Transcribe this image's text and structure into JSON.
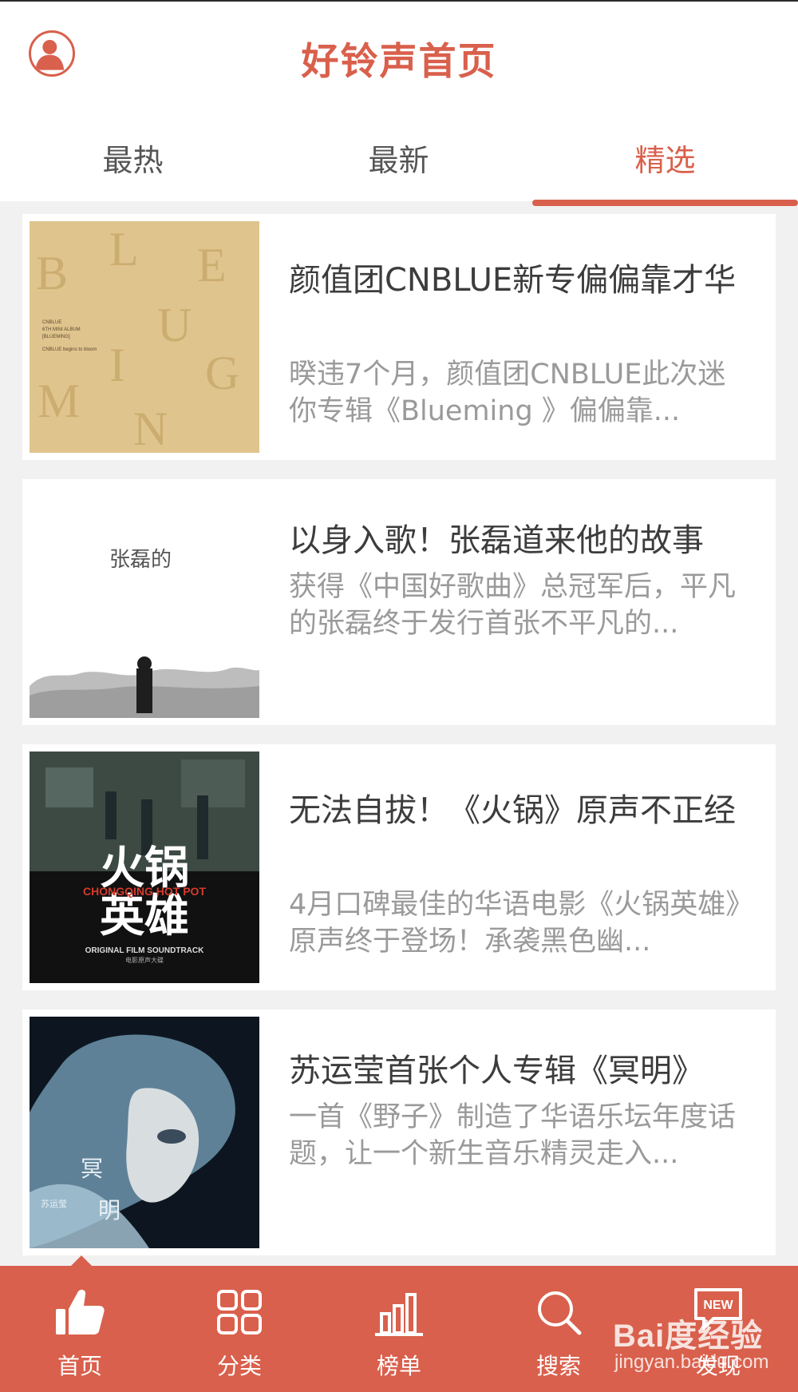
{
  "header": {
    "title": "好铃声首页"
  },
  "tabs": [
    {
      "label": "最热"
    },
    {
      "label": "最新"
    },
    {
      "label": "精选"
    }
  ],
  "active_tab": "精选",
  "articles": [
    {
      "title": "颜值团CNBLUE新专偏偏靠才华",
      "desc": "暌违7个月，颜值团CNBLUE此次迷你专辑《Blueming 》偏偏靠...",
      "cover_text": {
        "letters": [
          "B",
          "L",
          "U",
          "E",
          "M",
          "I",
          "N",
          "G"
        ],
        "line1": "CNBLUE",
        "line2": "6TH MINI ALBUM",
        "line3": "[BLUEMING]",
        "line4": "CNBLUE begins to bloom"
      }
    },
    {
      "title": "以身入歌！张磊道来他的故事",
      "desc": "获得《中国好歌曲》总冠军后，平凡的张磊终于发行首张不平凡的...",
      "cover_text": {
        "script": "张磊的"
      }
    },
    {
      "title": "无法自拔！《火锅》原声不正经",
      "desc": "4月口碑最佳的华语电影《火锅英雄》原声终于登场！承袭黑色幽...",
      "cover_text": {
        "big1": "火锅",
        "big2": "英雄",
        "en": "CHONGQING HOT POT",
        "sub": "ORIGINAL FILM SOUNDTRACK",
        "sub_cn": "电影原声大碟"
      }
    },
    {
      "title": "苏运莹首张个人专辑《冥明》",
      "desc": "一首《野子》制造了华语乐坛年度话题，让一个新生音乐精灵走入...",
      "cover_text": {
        "c1": "冥",
        "c2": "明",
        "artist": "苏运莹"
      }
    }
  ],
  "bottom_nav": [
    {
      "label": "首页",
      "icon": "thumbs-up-icon"
    },
    {
      "label": "分类",
      "icon": "grid-icon"
    },
    {
      "label": "榜单",
      "icon": "bar-chart-icon"
    },
    {
      "label": "搜索",
      "icon": "search-icon"
    },
    {
      "label": "发现",
      "icon": "new-bubble-icon",
      "badge": "NEW"
    }
  ],
  "watermark": {
    "logo": "Bai度经验",
    "url": "jingyan.baidu.com"
  },
  "colors": {
    "accent": "#d9604c",
    "title_text": "#3c3c3c",
    "desc_text": "#9a9a9a",
    "background": "#f1f1f1"
  }
}
